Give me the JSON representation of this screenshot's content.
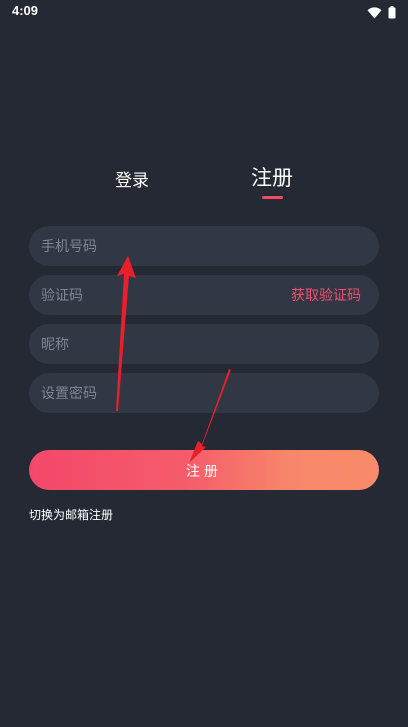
{
  "status_bar": {
    "time": "4:09",
    "icons": [
      "wifi-icon",
      "battery-icon"
    ]
  },
  "tabs": {
    "login_label": "登录",
    "register_label": "注册",
    "active": "register"
  },
  "form": {
    "phone_placeholder": "手机号码",
    "code_placeholder": "验证码",
    "get_code_label": "获取验证码",
    "nickname_placeholder": "昵称",
    "password_placeholder": "设置密码",
    "submit_label": "注册",
    "switch_label": "切换为邮箱注册"
  },
  "colors": {
    "background": "#252934",
    "field": "#323746",
    "accent": "#f24b63",
    "button_gradient_start": "#f4486a",
    "button_gradient_end": "#f88b6a",
    "annotation_arrow": "#e8202a"
  }
}
